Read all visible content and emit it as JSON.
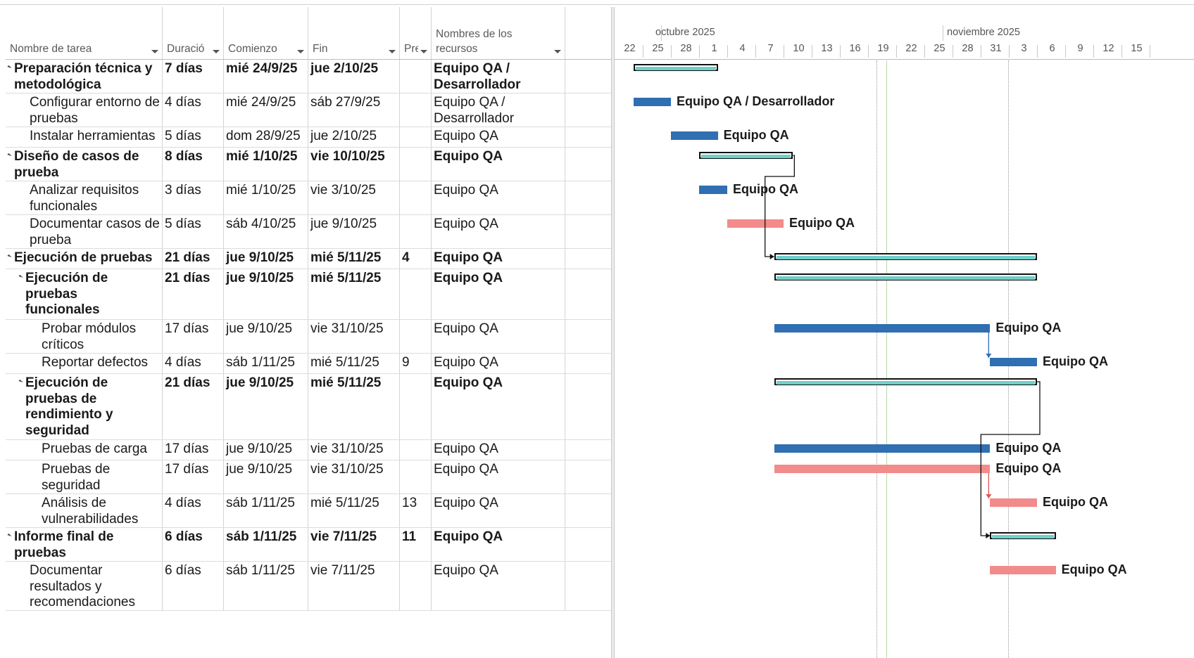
{
  "columns": {
    "name": "Nombre de tarea",
    "duration": "Duració",
    "start": "Comienzo",
    "finish": "Fin",
    "pred": "Pre",
    "resources": [
      "Nombres de los",
      "recursos"
    ]
  },
  "timeline": {
    "months": [
      "octubre 2025",
      "noviembre 2025"
    ],
    "days": [
      "22",
      "25",
      "28",
      "1",
      "4",
      "7",
      "10",
      "13",
      "16",
      "19",
      "22",
      "25",
      "28",
      "31",
      "3",
      "6",
      "9",
      "12",
      "15"
    ]
  },
  "tasks": [
    {
      "name": [
        "Preparación técnica y",
        "metodológica"
      ],
      "duration": "7 días",
      "start": "mié 24/9/25",
      "finish": "jue 2/10/25",
      "pred": "",
      "resources": [
        "Equipo QA /",
        "Desarrollador"
      ],
      "summary": true,
      "level": 0
    },
    {
      "name": [
        "Configurar entorno de",
        "pruebas"
      ],
      "duration": "4 días",
      "start": "mié 24/9/25",
      "finish": "sáb 27/9/25",
      "pred": "",
      "resources": [
        "Equipo QA /",
        "Desarrollador"
      ],
      "summary": false,
      "level": 1,
      "bar_label": "Equipo QA / Desarrollador"
    },
    {
      "name": [
        "Instalar herramientas"
      ],
      "duration": "5 días",
      "start": "dom 28/9/25",
      "finish": "jue 2/10/25",
      "pred": "",
      "resources": [
        "Equipo QA"
      ],
      "summary": false,
      "level": 1,
      "bar_label": "Equipo QA"
    },
    {
      "name": [
        "Diseño de casos de",
        "prueba"
      ],
      "duration": "8 días",
      "start": "mié 1/10/25",
      "finish": "vie 10/10/25",
      "pred": "",
      "resources": [
        "Equipo QA"
      ],
      "summary": true,
      "level": 0
    },
    {
      "name": [
        "Analizar requisitos",
        "funcionales"
      ],
      "duration": "3 días",
      "start": "mié 1/10/25",
      "finish": "vie 3/10/25",
      "pred": "",
      "resources": [
        "Equipo QA"
      ],
      "summary": false,
      "level": 1,
      "bar_label": "Equipo QA"
    },
    {
      "name": [
        "Documentar casos de",
        "prueba"
      ],
      "duration": "5 días",
      "start": "sáb 4/10/25",
      "finish": "jue 9/10/25",
      "pred": "",
      "resources": [
        "Equipo QA"
      ],
      "summary": false,
      "level": 1,
      "bar_label": "Equipo QA"
    },
    {
      "name": [
        "Ejecución de pruebas"
      ],
      "duration": "21 días",
      "start": "jue 9/10/25",
      "finish": "mié 5/11/25",
      "pred": "4",
      "resources": [
        "Equipo QA"
      ],
      "summary": true,
      "level": 0
    },
    {
      "name": [
        "Ejecución de",
        "pruebas",
        "funcionales"
      ],
      "duration": "21 días",
      "start": "jue 9/10/25",
      "finish": "mié 5/11/25",
      "pred": "",
      "resources": [
        "Equipo QA"
      ],
      "summary": true,
      "level": 1
    },
    {
      "name": [
        "Probar módulos",
        "críticos"
      ],
      "duration": "17 días",
      "start": "jue 9/10/25",
      "finish": "vie 31/10/25",
      "pred": "",
      "resources": [
        "Equipo QA"
      ],
      "summary": false,
      "level": 2,
      "bar_label": "Equipo QA"
    },
    {
      "name": [
        "Reportar defectos"
      ],
      "duration": "4 días",
      "start": "sáb 1/11/25",
      "finish": "mié 5/11/25",
      "pred": "9",
      "resources": [
        "Equipo QA"
      ],
      "summary": false,
      "level": 2,
      "bar_label": "Equipo QA"
    },
    {
      "name": [
        "Ejecución de",
        "pruebas de",
        "rendimiento y",
        "seguridad"
      ],
      "duration": "21 días",
      "start": "jue 9/10/25",
      "finish": "mié 5/11/25",
      "pred": "",
      "resources": [
        "Equipo QA"
      ],
      "summary": true,
      "level": 1
    },
    {
      "name": [
        "Pruebas de carga"
      ],
      "duration": "17 días",
      "start": "jue 9/10/25",
      "finish": "vie 31/10/25",
      "pred": "",
      "resources": [
        "Equipo QA"
      ],
      "summary": false,
      "level": 2,
      "bar_label": "Equipo QA"
    },
    {
      "name": [
        "Pruebas de",
        "seguridad"
      ],
      "duration": "17 días",
      "start": "jue 9/10/25",
      "finish": "vie 31/10/25",
      "pred": "",
      "resources": [
        "Equipo QA"
      ],
      "summary": false,
      "level": 2,
      "bar_label": "Equipo QA"
    },
    {
      "name": [
        "Análisis de",
        "vulnerabilidades"
      ],
      "duration": "4 días",
      "start": "sáb 1/11/25",
      "finish": "mié 5/11/25",
      "pred": "13",
      "resources": [
        "Equipo QA"
      ],
      "summary": false,
      "level": 2,
      "bar_label": "Equipo QA"
    },
    {
      "name": [
        "Informe final de",
        "pruebas"
      ],
      "duration": "6 días",
      "start": "sáb 1/11/25",
      "finish": "vie 7/11/25",
      "pred": "11",
      "resources": [
        "Equipo QA"
      ],
      "summary": true,
      "level": 0
    },
    {
      "name": [
        "Documentar",
        "resultados y",
        "recomendaciones"
      ],
      "duration": "6 días",
      "start": "sáb 1/11/25",
      "finish": "vie 7/11/25",
      "pred": "",
      "resources": [
        "Equipo QA"
      ],
      "summary": false,
      "level": 1,
      "bar_label": "Equipo QA"
    }
  ],
  "colors": {
    "task_blue": "#2f6fb2",
    "task_pink": "#f28b8b",
    "summary_fill": "#6fcfcb"
  }
}
